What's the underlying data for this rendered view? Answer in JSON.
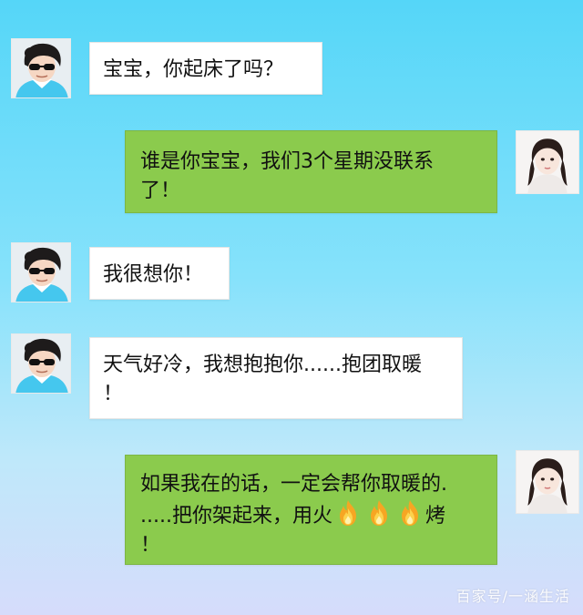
{
  "messages": [
    {
      "sender": "him",
      "text": "宝宝，你起床了吗？"
    },
    {
      "sender": "her",
      "lines": [
        "谁是你宝宝，我们3个星期没联系",
        "了！"
      ]
    },
    {
      "sender": "him",
      "text": "我很想你！"
    },
    {
      "sender": "him",
      "lines": [
        "天气好冷，我想抱抱你......抱团取暖",
        "！"
      ]
    },
    {
      "sender": "her",
      "lines": [
        "如果我在的话，一定会帮你取暖的.",
        ".....把你架起来，用火",
        "烤",
        "！"
      ]
    }
  ],
  "icons": {
    "fire": "fire-emoji-icon",
    "him_avatar": "male-avatar-sunglasses",
    "her_avatar": "female-avatar-braids"
  },
  "colors": {
    "outgoing_bubble": "#8bcb4d",
    "incoming_bubble": "#ffffff",
    "background_top": "#55d6f8",
    "background_bottom": "#d6dcfb"
  },
  "watermark": "百家号/一涵生活"
}
